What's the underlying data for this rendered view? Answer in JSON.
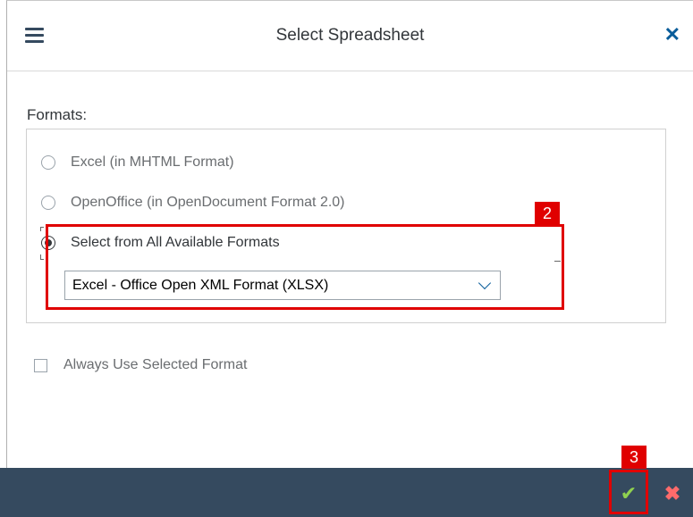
{
  "dialog": {
    "title": "Select Spreadsheet",
    "menu_icon": "hamburger-menu-icon",
    "close_icon": "close-icon"
  },
  "formats": {
    "label": "Formats:",
    "options": [
      {
        "label": "Excel (in MHTML Format)",
        "selected": false
      },
      {
        "label": "OpenOffice (in OpenDocument Format 2.0)",
        "selected": false
      },
      {
        "label": "Select from All Available Formats",
        "selected": true
      }
    ],
    "select_value": "Excel - Office Open XML Format (XLSX)"
  },
  "always_use": {
    "label": "Always Use Selected Format",
    "checked": false
  },
  "annotations": {
    "box2_label": "2",
    "box3_label": "3",
    "color": "#e00000"
  },
  "footer": {
    "ok_icon": "checkmark-icon",
    "cancel_icon": "cancel-x-icon",
    "ok_symbol": "✔",
    "cancel_symbol": "✖",
    "background": "#354a5f"
  },
  "colors": {
    "accent": "#0a5d9a",
    "ok_green": "#8fd14f",
    "cancel_red": "#ff6b6b"
  }
}
